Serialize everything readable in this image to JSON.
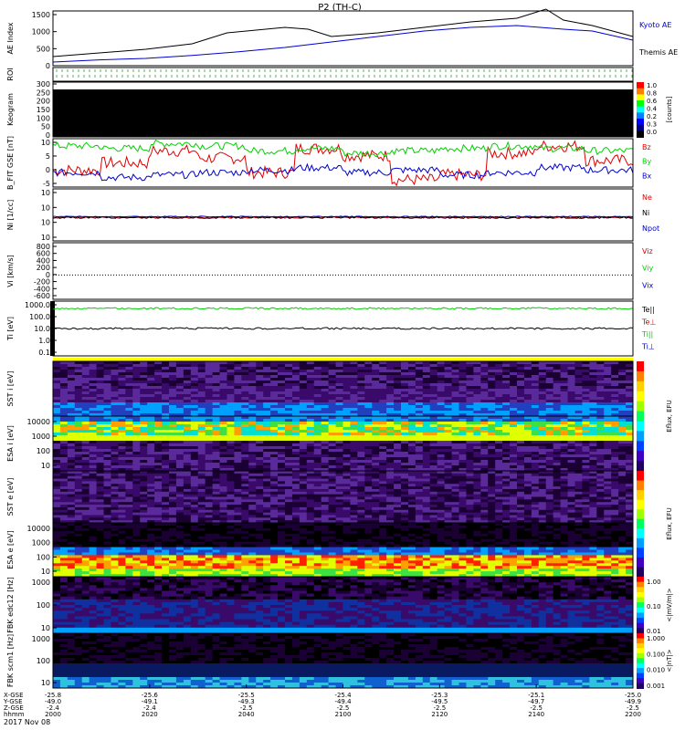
{
  "title": "P2 (TH-C)",
  "colors": {
    "black": "#000000",
    "red": "#e00000",
    "green": "#00d000",
    "blue": "#0000d0",
    "yellow": "#ffff00",
    "navy": "#000080",
    "white": "#ffffff"
  },
  "chart_data": [
    {
      "id": "ae",
      "type": "line",
      "ylabel": "AE Index",
      "ylim": [
        0,
        1500
      ],
      "yticks": [
        "0",
        "500",
        "1000",
        "1500"
      ],
      "series": [
        {
          "name": "Kyoto AE",
          "color": "#0000d0",
          "x": [
            0,
            0.08,
            0.16,
            0.24,
            0.32,
            0.4,
            0.48,
            0.56,
            0.64,
            0.72,
            0.8,
            0.88,
            0.93,
            1.0
          ],
          "y": [
            100,
            160,
            200,
            280,
            380,
            500,
            650,
            800,
            950,
            1050,
            1100,
            1000,
            950,
            700
          ]
        },
        {
          "name": "Themis AE",
          "color": "#000000",
          "x": [
            0,
            0.08,
            0.16,
            0.24,
            0.3,
            0.4,
            0.44,
            0.48,
            0.56,
            0.64,
            0.72,
            0.8,
            0.85,
            0.88,
            0.93,
            1.0
          ],
          "y": [
            250,
            350,
            450,
            600,
            900,
            1050,
            1000,
            800,
            900,
            1050,
            1200,
            1300,
            1550,
            1250,
            1100,
            800
          ]
        }
      ]
    },
    {
      "id": "roi",
      "type": "table",
      "ylabel": "ROI"
    },
    {
      "id": "keogram",
      "type": "heatmap",
      "ylabel": "Keogram",
      "yticks": [
        "300",
        "250",
        "200",
        "150",
        "100",
        "50",
        "0"
      ],
      "colorbar_ticks": [
        "1.0",
        "0.8",
        "0.6",
        "0.4",
        "0.2",
        "0.3",
        "0.0"
      ],
      "colorbar_label": "[counts]"
    },
    {
      "id": "bfield",
      "type": "line",
      "ylabel": "B_FIT GSE [nT]",
      "ylim": [
        -10,
        10
      ],
      "yticks": [
        "10",
        "5",
        "0",
        "-5"
      ],
      "series": [
        {
          "name": "Bz",
          "color": "#e00000",
          "y": [
            -3,
            0,
            5,
            2,
            -4,
            6,
            3,
            -7,
            -5,
            4,
            7,
            1
          ]
        },
        {
          "name": "By",
          "color": "#00d000",
          "y": [
            7,
            6,
            8,
            7,
            5,
            6,
            4,
            5,
            6,
            7,
            6,
            5
          ]
        },
        {
          "name": "Bx",
          "color": "#0000d0",
          "y": [
            -4,
            -6,
            -5,
            -4,
            -3,
            -2,
            -4,
            -3,
            -5,
            -4,
            -2,
            -3
          ]
        }
      ]
    },
    {
      "id": "density",
      "type": "line",
      "ylabel": "Ni [1/cc]",
      "yticks": [
        "10",
        "10",
        "10",
        "10"
      ],
      "series": [
        {
          "name": "Ne",
          "color": "#e00000"
        },
        {
          "name": "Ni",
          "color": "#000000"
        },
        {
          "name": "Npot",
          "color": "#0000d0"
        }
      ]
    },
    {
      "id": "velocity",
      "type": "line",
      "ylabel": "Vi [km/s]",
      "ylim": [
        -600,
        800
      ],
      "yticks": [
        "800",
        "600",
        "400",
        "200",
        "0",
        "-200",
        "-400",
        "-600"
      ],
      "series": [
        {
          "name": "Viz",
          "color": "#e00000"
        },
        {
          "name": "Viy",
          "color": "#00d000"
        },
        {
          "name": "Vix",
          "color": "#0000d0"
        }
      ]
    },
    {
      "id": "temperature",
      "type": "line",
      "ylabel": "Ti [eV]",
      "yticks": [
        "1000.0",
        "100.0",
        "10.0",
        "1.0",
        "0.1"
      ],
      "series": [
        {
          "name": "Te||",
          "color": "#000000"
        },
        {
          "name": "Te⊥",
          "color": "#e00000"
        },
        {
          "name": "Ti||",
          "color": "#00d000"
        },
        {
          "name": "Ti⊥",
          "color": "#0000d0"
        }
      ]
    },
    {
      "id": "sst_i",
      "type": "heatmap",
      "ylabel": "SST i [eV]"
    },
    {
      "id": "esa_i",
      "type": "heatmap",
      "ylabel": "ESA i [eV]",
      "yticks": [
        "10000",
        "1000",
        "100",
        "10"
      ]
    },
    {
      "id": "sst_e",
      "type": "heatmap",
      "ylabel": "SST e [eV]"
    },
    {
      "id": "esa_e",
      "type": "heatmap",
      "ylabel": "ESA e [eV]",
      "yticks": [
        "10000",
        "1000",
        "100",
        "10"
      ]
    },
    {
      "id": "fbk_e",
      "type": "heatmap",
      "ylabel": "FBK edc12 [Hz]",
      "yticks": [
        "1000",
        "100",
        "10"
      ],
      "colorbar_ticks": [
        "1.00",
        "0.10",
        "0.01"
      ],
      "colorbar_label": "<|mV/m|>"
    },
    {
      "id": "fbk_b",
      "type": "heatmap",
      "ylabel": "FBK scm1 [Hz]",
      "yticks": [
        "1000",
        "100",
        "10"
      ],
      "colorbar_ticks": [
        "1.000",
        "0.100",
        "0.010",
        "0.001"
      ],
      "colorbar_label": "<|nT|>"
    }
  ],
  "labels": {
    "ae_kyoto": "Kyoto AE",
    "ae_themis": "Themis AE",
    "eflux": "Eflux, EFU",
    "date": "2017 Nov 08",
    "row_labels": [
      "X-GSE",
      "Y-GSE",
      "Z-GSE",
      "hhmm"
    ]
  },
  "time_axis": {
    "ticks": [
      {
        "pos": 0.0,
        "x": "-25.8",
        "y": "-49.0",
        "z": "-2.4",
        "t": "2000"
      },
      {
        "pos": 0.2,
        "x": "-25.6",
        "y": "-49.1",
        "z": "-2.4",
        "t": "2020"
      },
      {
        "pos": 0.4,
        "x": "-25.5",
        "y": "-49.3",
        "z": "-2.5",
        "t": "2040"
      },
      {
        "pos": 0.6,
        "x": "-25.4",
        "y": "-49.4",
        "z": "-2.5",
        "t": "2100"
      },
      {
        "pos": 0.8,
        "x": "-25.3",
        "y": "-49.5",
        "z": "-2.5",
        "t": "2120"
      },
      {
        "pos": 1.0,
        "x": "-25.1",
        "y": "-49.7",
        "z": "-2.5",
        "t": "2140"
      },
      {
        "pos": 1.2,
        "x": "-25.0",
        "y": "-49.9",
        "z": "-2.5",
        "t": "2200"
      }
    ]
  }
}
